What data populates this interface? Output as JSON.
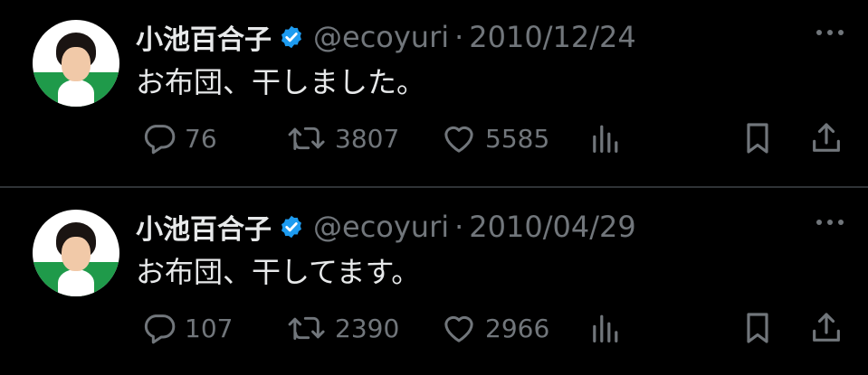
{
  "tweets": [
    {
      "name": "小池百合子",
      "handle": "@ecoyuri",
      "separator": "·",
      "date": "2010/12/24",
      "text": "お布団、干しました。",
      "replies": "76",
      "retweets": "3807",
      "likes": "5585"
    },
    {
      "name": "小池百合子",
      "handle": "@ecoyuri",
      "separator": "·",
      "date": "2010/04/29",
      "text": "お布団、干してます。",
      "replies": "107",
      "retweets": "2390",
      "likes": "2966"
    }
  ],
  "icons": {
    "verified": "verified-badge-icon",
    "more": "more-dots-icon",
    "reply": "reply-bubble-icon",
    "retweet": "retweet-icon",
    "like": "heart-icon",
    "views": "views-bar-chart-icon",
    "bookmark": "bookmark-icon",
    "share": "share-upload-icon"
  },
  "colors": {
    "background": "#000000",
    "primary_text": "#e7e9ea",
    "secondary_text": "#71767b",
    "verified_blue": "#1d9bf0",
    "divider": "#2f3336"
  }
}
